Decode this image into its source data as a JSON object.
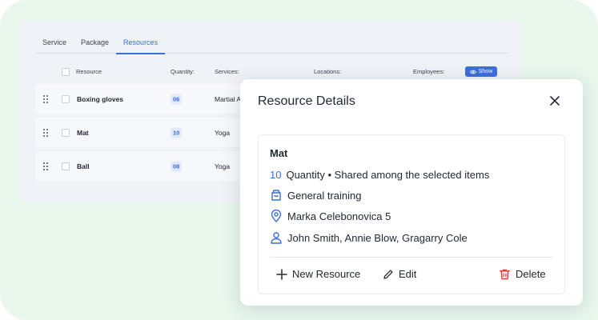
{
  "tabs": [
    {
      "label": "Service"
    },
    {
      "label": "Package"
    },
    {
      "label": "Resources"
    }
  ],
  "table": {
    "headers": {
      "resource": "Resource",
      "quantity": "Quantity:",
      "services": "Services:",
      "locations": "Locations:",
      "employees": "Employees:"
    },
    "show_label": "Show",
    "rows": [
      {
        "name": "Boxing gloves",
        "qty": "06",
        "service": "Martial A"
      },
      {
        "name": "Mat",
        "qty": "10",
        "service": "Yoga"
      },
      {
        "name": "Ball",
        "qty": "08",
        "service": "Yoga"
      }
    ]
  },
  "modal": {
    "title": "Resource Details",
    "card_title": "Mat",
    "quantity_value": "10",
    "quantity_text": "Quantity • Shared among the selected items",
    "service": "General training",
    "location": "Marka Celebonovica 5",
    "employees": "John Smith, Annie Blow, Gragarry Cole",
    "new_resource_label": "New Resource",
    "edit_label": "Edit",
    "delete_label": "Delete"
  },
  "colors": {
    "accent": "#3b6fd9",
    "delete": "#e53935",
    "background": "#e9f7ed"
  }
}
